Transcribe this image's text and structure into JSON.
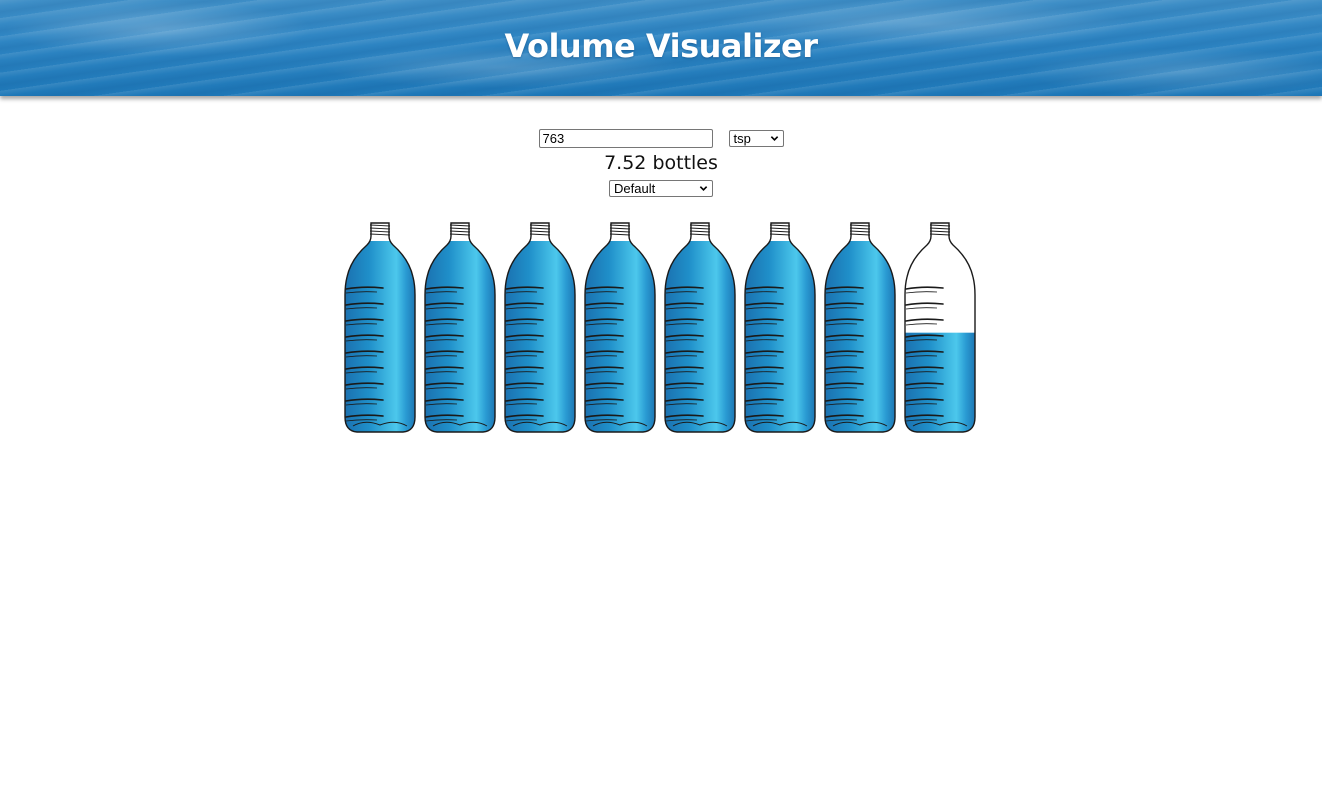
{
  "header": {
    "title": "Volume Visualizer"
  },
  "controls": {
    "amount_value": "763",
    "unit_selected": "tsp",
    "result_text": "7.52 bottles",
    "preset_selected": "Default"
  },
  "bottles": {
    "fill_levels": [
      1,
      1,
      1,
      1,
      1,
      1,
      1,
      0.52
    ],
    "liquid_color": "#1f8fc9",
    "liquid_highlight": "#4cc8ec",
    "outline_color": "#1a1a1a"
  }
}
